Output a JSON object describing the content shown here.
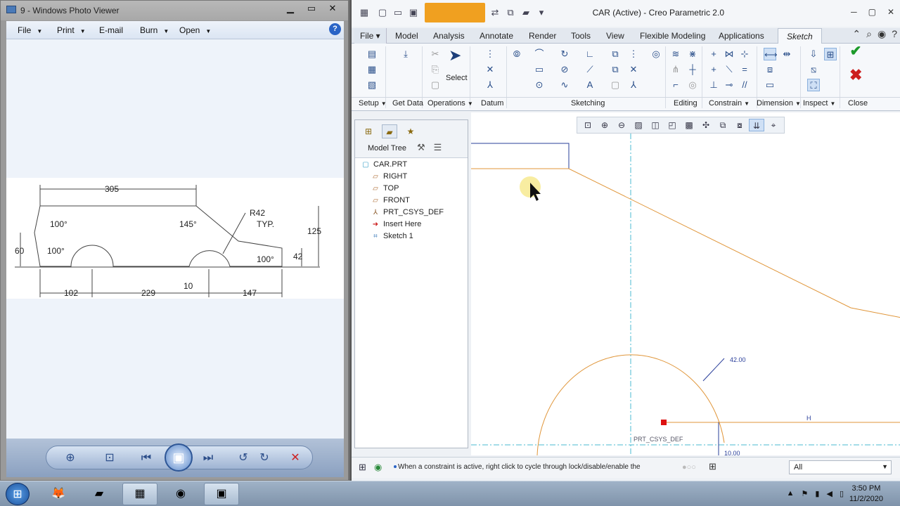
{
  "photo_viewer": {
    "title": "9 - Windows Photo Viewer",
    "menu": [
      {
        "label": "File",
        "caret": true
      },
      {
        "label": "Print",
        "caret": true
      },
      {
        "label": "E-mail",
        "caret": false
      },
      {
        "label": "Burn",
        "caret": true
      },
      {
        "label": "Open",
        "caret": true
      }
    ],
    "help_label": "?",
    "drawing": {
      "dims": [
        "305",
        "100°",
        "145°",
        "R42",
        "TYP.",
        "125",
        "60",
        "100°",
        "42",
        "100°",
        "10",
        "102",
        "229",
        "147"
      ]
    }
  },
  "creo": {
    "title": "CAR (Active) - Creo Parametric 2.0",
    "tabs": [
      "File",
      "Model",
      "Analysis",
      "Annotate",
      "Render",
      "Tools",
      "View",
      "Flexible Modeling",
      "Applications",
      "Sketch"
    ],
    "active_tab": "Sketch",
    "select_label": "Select",
    "groups": [
      {
        "label": "Setup",
        "caret": true
      },
      {
        "label": "Get Data",
        "caret": false
      },
      {
        "label": "Operations",
        "caret": true
      },
      {
        "label": "Datum",
        "caret": false
      },
      {
        "label": "Sketching",
        "caret": false
      },
      {
        "label": "Editing",
        "caret": false
      },
      {
        "label": "Constrain",
        "caret": true
      },
      {
        "label": "Dimension",
        "caret": true
      },
      {
        "label": "Inspect",
        "caret": true
      },
      {
        "label": "Close",
        "caret": false
      }
    ],
    "model_tree": {
      "title": "Model Tree",
      "items": [
        {
          "label": "CAR.PRT",
          "icon": "part-icon"
        },
        {
          "label": "RIGHT",
          "icon": "datum-plane-icon"
        },
        {
          "label": "TOP",
          "icon": "datum-plane-icon"
        },
        {
          "label": "FRONT",
          "icon": "datum-plane-icon"
        },
        {
          "label": "PRT_CSYS_DEF",
          "icon": "csys-icon"
        },
        {
          "label": "Insert Here",
          "icon": "insert-arrow-icon"
        },
        {
          "label": "Sketch 1",
          "icon": "sketch-icon"
        }
      ]
    },
    "sketch_labels": {
      "radius_dim": "42.00",
      "csys": "PRT_CSYS_DEF",
      "h_constraint": "H",
      "small_dim": "10.00"
    },
    "status_message": "When a constraint is active, right click to cycle through lock/disable/enable the",
    "filter_value": "All"
  },
  "taskbar": {
    "time": "3:50 PM",
    "date": "11/2/2020"
  }
}
